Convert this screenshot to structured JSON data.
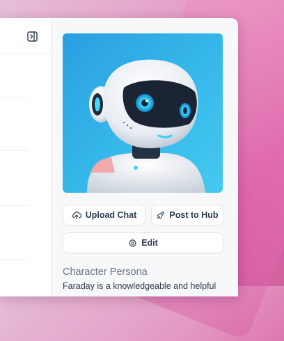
{
  "character": {
    "avatar_alt": "robot avatar",
    "upload_chat_label": "Upload Chat",
    "post_to_hub_label": "Post to Hub",
    "edit_label": "Edit",
    "persona_title": "Character Persona",
    "persona_text": "Faraday is a knowledgeable and helpful"
  },
  "icons": {
    "panel_toggle": "sidebar-toggle-icon",
    "upload": "cloud-upload-icon",
    "post": "rocket-icon",
    "edit": "gear-icon"
  },
  "colors": {
    "avatar_bg": "#36b9ea",
    "robot_eye": "#1ec8ff",
    "button_text": "#2b3a4f"
  }
}
